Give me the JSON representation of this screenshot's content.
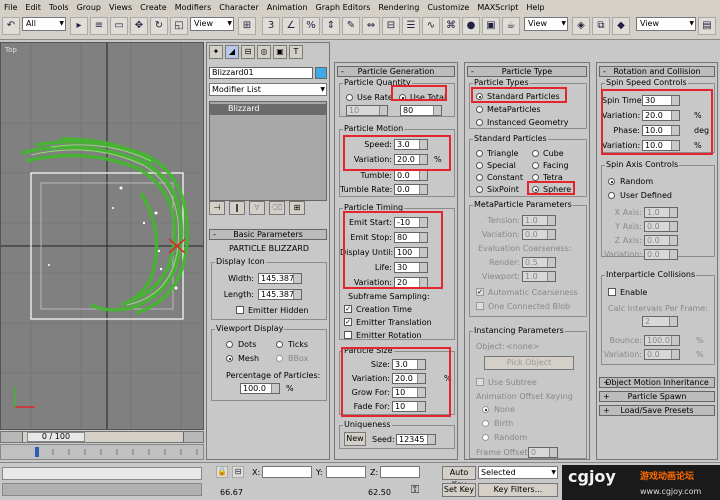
{
  "menu": [
    "File",
    "Edit",
    "Tools",
    "Group",
    "Views",
    "Create",
    "Modifiers",
    "Character",
    "Animation",
    "Graph Editors",
    "Rendering",
    "Customize",
    "MAXScript",
    "Help"
  ],
  "toolbar": {
    "filter": "All",
    "refcoord1": "View",
    "refcoord2": "View",
    "refcoord3": "View"
  },
  "viewport": {
    "label": "Top",
    "timeslider": "0 / 100"
  },
  "modify": {
    "object_name": "Blizzard01",
    "modifier_list": "Modifier List",
    "stack_item": "Blizzard",
    "color": "#3fa9e8"
  },
  "basic": {
    "title": "Basic Parameters",
    "heading": "PARTICLE BLIZZARD",
    "display_icon": "Display Icon",
    "width_label": "Width:",
    "width": "145.387",
    "length_label": "Length:",
    "length": "145.387",
    "emitter_hidden": "Emitter Hidden",
    "viewport_display": "Viewport Display",
    "dots": "Dots",
    "ticks": "Ticks",
    "mesh": "Mesh",
    "bbox": "BBox",
    "pct_label": "Percentage of Particles:",
    "pct": "100.0",
    "pct_unit": "%"
  },
  "gen": {
    "title": "Particle Generation",
    "quantity": "Particle Quantity",
    "use_rate": "Use Rate",
    "use_total": "Use Total",
    "rate": "10",
    "total": "80",
    "motion": "Particle Motion",
    "speed_label": "Speed:",
    "speed": "3.0",
    "variation_label": "Variation:",
    "speed_var": "20.0",
    "pct": "%",
    "tumble_label": "Tumble:",
    "tumble": "0.0",
    "tumble_rate_label": "Tumble Rate:",
    "tumble_rate": "0.0",
    "timing": "Particle Timing",
    "emit_start_label": "Emit Start:",
    "emit_start": "-10",
    "emit_stop_label": "Emit Stop:",
    "emit_stop": "80",
    "display_until_label": "Display Until:",
    "display_until": "100",
    "life_label": "Life:",
    "life": "30",
    "life_var": "20",
    "subframe": "Subframe Sampling:",
    "creation_time": "Creation Time",
    "emitter_translation": "Emitter Translation",
    "emitter_rotation": "Emitter Rotation",
    "size_group": "Particle Size",
    "size_label": "Size:",
    "size": "3.0",
    "size_var": "20.0",
    "grow_label": "Grow For:",
    "grow": "10",
    "fade_label": "Fade For:",
    "fade": "10",
    "uniqueness": "Uniqueness",
    "new": "New",
    "seed_label": "Seed:",
    "seed": "12345"
  },
  "ptype": {
    "title": "Particle Type",
    "types": "Particle Types",
    "standard": "Standard Particles",
    "meta": "MetaParticles",
    "instanced": "Instanced Geometry",
    "std_group": "Standard Particles",
    "triangle": "Triangle",
    "cube": "Cube",
    "special": "Special",
    "facing": "Facing",
    "constant": "Constant",
    "tetra": "Tetra",
    "sixpoint": "SixPoint",
    "sphere": "Sphere",
    "meta_group": "MetaParticle Parameters",
    "tension_label": "Tension:",
    "tension": "1.0",
    "variation_label": "Variation:",
    "meta_var": "0.0",
    "eval": "Evaluation Coarseness:",
    "render_label": "Render:",
    "render": "0.5",
    "viewport_label": "Viewport:",
    "viewport_val": "1.0",
    "auto": "Automatic Coarseness",
    "one_blob": "One Connected Blob",
    "inst_group": "Instancing Parameters",
    "object_label": "Object:",
    "object_val": "<none>",
    "pick": "Pick Object",
    "use_subtree": "Use Subtree",
    "anim_offset": "Animation Offset Keying",
    "none": "None",
    "birth": "Birth",
    "random": "Random",
    "frame_offset_label": "Frame Offset:",
    "frame_offset": "0"
  },
  "rot": {
    "title": "Rotation and Collision",
    "spin": "Spin Speed Controls",
    "spin_time_label": "Spin Time:",
    "spin_time": "30",
    "variation_label": "Variation:",
    "spin_var": "20.0",
    "pct": "%",
    "phase_label": "Phase:",
    "phase": "10.0",
    "deg": "deg",
    "phase_var": "10.0",
    "axis": "Spin Axis Controls",
    "random": "Random",
    "user": "User Defined",
    "xaxis": "X Axis:",
    "yaxis": "Y Axis:",
    "zaxis": "Z Axis:",
    "axis_val": "1.0",
    "zero": "0.0",
    "collision": "Interparticle Collisions",
    "enable": "Enable",
    "calc": "Calc Intervals Per Frame:",
    "calc_val": "2",
    "bounce_label": "Bounce:",
    "bounce": "100.0",
    "rollouts": [
      "Object Motion Inheritance",
      "Particle Spawn",
      "Load/Save Presets"
    ]
  },
  "status": {
    "x": "X:",
    "y": "Y:",
    "z": "Z:",
    "coord1": "66.67",
    "coord2": "62.50",
    "autokey": "Auto Key",
    "selected": "Selected",
    "setkey": "Set Key",
    "keyfilters": "Key Filters...",
    "frame": "0"
  },
  "watermark": {
    "brand": "cgjoy",
    "cn": "游戏动画论坛",
    "url": "www.cgjoy.com"
  }
}
